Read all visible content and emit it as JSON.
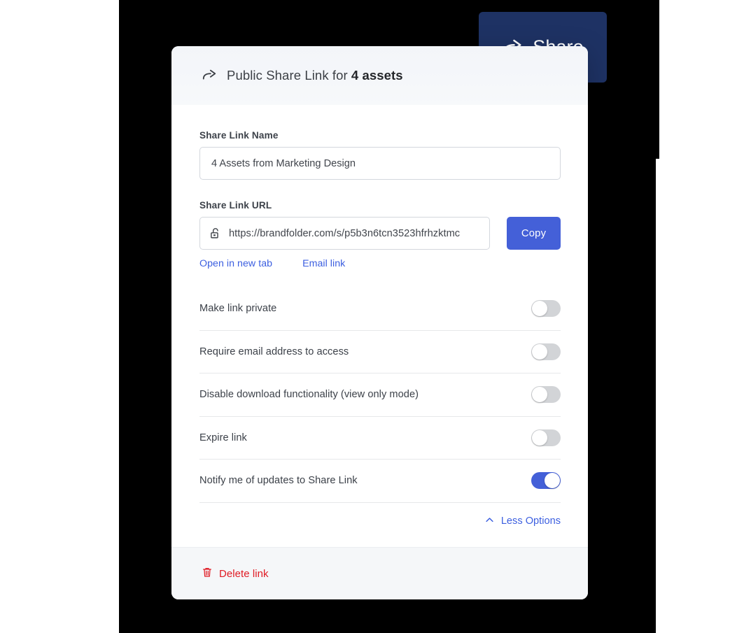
{
  "share_button": {
    "label": "Share",
    "icon": "share-arrow-icon",
    "bg_color": "#1e3264",
    "text_color": "#ffffff"
  },
  "dialog": {
    "header": {
      "icon": "share-arrow-icon",
      "title_prefix": "Public Share Link for",
      "title_strong": "4 assets"
    },
    "fields": {
      "name": {
        "label": "Share Link Name",
        "value": "4 Assets from Marketing Design",
        "placeholder": "Share Link Name"
      },
      "url": {
        "label": "Share Link URL",
        "value": "https://brandfolder.com/s/p5b3n6tcn3523hfrhzktmc",
        "placeholder": "Share Link URL",
        "lock_icon": "unlocked-padlock-icon",
        "copy_label": "Copy"
      }
    },
    "inline_links": [
      {
        "label": "Open in new tab",
        "name": "open-in-new-tab-link"
      },
      {
        "label": "Email link",
        "name": "email-link"
      }
    ],
    "toggles": [
      {
        "label": "Make link private",
        "on": false,
        "name": "toggle-make-link-private"
      },
      {
        "label": "Require email address to access",
        "on": false,
        "name": "toggle-require-email"
      },
      {
        "label": "Disable download functionality (view only mode)",
        "on": false,
        "name": "toggle-disable-download"
      },
      {
        "label": "Expire link",
        "on": false,
        "name": "toggle-expire-link"
      },
      {
        "label": "Notify me of updates to Share Link",
        "on": true,
        "name": "toggle-notify-updates"
      }
    ],
    "less_options": {
      "label": "Less Options",
      "icon": "chevron-up-icon"
    },
    "footer": {
      "delete_label": "Delete link",
      "delete_icon": "trash-icon",
      "delete_color": "#e01b24"
    }
  },
  "colors": {
    "accent_blue": "#4460d8",
    "link_blue": "#3c5fe0",
    "navy": "#1e3264",
    "danger_red": "#e01b24",
    "backdrop": "#000000"
  }
}
